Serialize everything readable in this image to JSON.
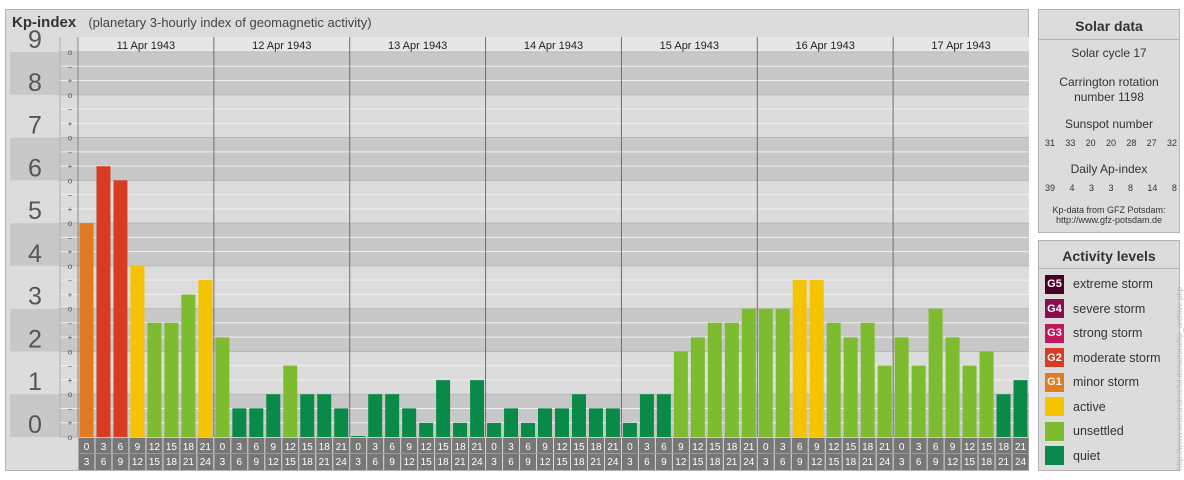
{
  "header": {
    "title": "Kp-index",
    "subtitle": "(planetary 3-hourly index of geomagnetic activity)"
  },
  "y_tick_labels": [
    "0",
    "1",
    "2",
    "3",
    "4",
    "5",
    "6",
    "7",
    "8",
    "9"
  ],
  "minor_tick_labels": [
    "o",
    "+",
    "–",
    "o",
    "+",
    "–",
    "o",
    "+",
    "–",
    "o",
    "+",
    "–",
    "o",
    "+",
    "–",
    "o",
    "+",
    "–",
    "o",
    "+",
    "–",
    "o",
    "+",
    "–",
    "o",
    "+",
    "–",
    "o"
  ],
  "hour_labels": [
    [
      "0",
      "3"
    ],
    [
      "3",
      "6"
    ],
    [
      "6",
      "9"
    ],
    [
      "9",
      "12"
    ],
    [
      "12",
      "15"
    ],
    [
      "15",
      "18"
    ],
    [
      "18",
      "21"
    ],
    [
      "21",
      "24"
    ]
  ],
  "colors": {
    "quiet": "#0a8a48",
    "unsettled": "#7cbc2e",
    "active": "#f6c300",
    "minor_storm": "#e07b24",
    "moderate_storm": "#d83a22",
    "strong_storm": "#c2185b",
    "severe_storm": "#880e4f",
    "extreme_storm": "#4a0024",
    "band_dark": "#c8c8c8",
    "band_light": "#dcdcdc"
  },
  "chart_data": {
    "type": "bar",
    "title": "Kp-index",
    "ylim": [
      0,
      9
    ],
    "days": [
      "11 Apr 1943",
      "12 Apr 1943",
      "13 Apr 1943",
      "14 Apr 1943",
      "15 Apr 1943",
      "16 Apr 1943",
      "17 Apr 1943"
    ],
    "intervals_per_day": 8,
    "series": [
      {
        "values": [
          5.0,
          6.33,
          6.0,
          4.0,
          2.67,
          2.67,
          3.33,
          3.67,
          2.33,
          0.67,
          0.67,
          1.0,
          1.67,
          1.0,
          1.0,
          0.67,
          0.0,
          1.0,
          1.0,
          0.67,
          0.33,
          1.33,
          0.33,
          1.33,
          0.33,
          0.67,
          0.33,
          0.67,
          0.67,
          1.0,
          0.67,
          0.67,
          0.33,
          1.0,
          1.0,
          2.0,
          2.33,
          2.67,
          2.67,
          3.0,
          3.0,
          3.0,
          3.67,
          3.67,
          2.67,
          2.33,
          2.67,
          1.67,
          2.33,
          1.67,
          3.0,
          2.33,
          1.67,
          2.0,
          1.0,
          1.33
        ]
      }
    ]
  },
  "solar": {
    "title": "Solar data",
    "cycle": "Solar cycle 17",
    "carrington_1": "Carrington rotation",
    "carrington_2": "number 1198",
    "sunspot_title": "Sunspot number",
    "sunspot_values": [
      "31",
      "33",
      "20",
      "20",
      "28",
      "27",
      "32"
    ],
    "ap_title": "Daily Ap-index",
    "ap_values": [
      "39",
      "4",
      "3",
      "3",
      "8",
      "14",
      "8"
    ],
    "source_1": "Kp-data from GFZ Potsdam:",
    "source_2": "http://www.gfz-potsdam.de"
  },
  "legend": {
    "title": "Activity levels",
    "items": [
      {
        "code": "G5",
        "label": "extreme storm",
        "color": "#4a0024"
      },
      {
        "code": "G4",
        "label": "severe storm",
        "color": "#880e4f"
      },
      {
        "code": "G3",
        "label": "strong storm",
        "color": "#c2185b"
      },
      {
        "code": "G2",
        "label": "moderate storm",
        "color": "#d83a22"
      },
      {
        "code": "G1",
        "label": "minor storm",
        "color": "#e07b24"
      },
      {
        "code": "",
        "label": "active",
        "color": "#f6c300"
      },
      {
        "code": "",
        "label": "unsettled",
        "color": "#7cbc2e"
      },
      {
        "code": "",
        "label": "quiet",
        "color": "#0a8a48"
      }
    ]
  },
  "credit": "http://www.tiedesnsieteful.de/aurora/kp_archive.php"
}
